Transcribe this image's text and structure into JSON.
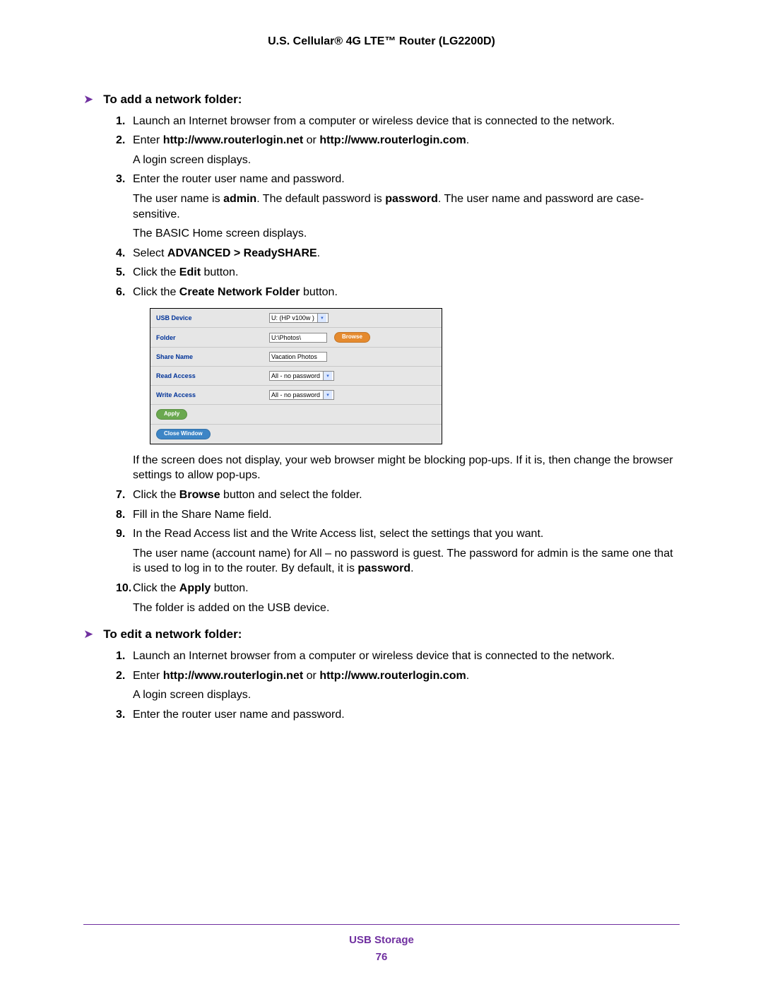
{
  "header": {
    "title": "U.S. Cellular® 4G LTE™ Router (LG2200D)"
  },
  "sections": {
    "add": {
      "heading": "To add a network folder:",
      "steps": {
        "1": {
          "num": "1.",
          "text": "Launch an Internet browser from a computer or wireless device that is connected to the network."
        },
        "2": {
          "num": "2.",
          "pre": "Enter ",
          "b1": "http://www.routerlogin.net",
          "mid": " or ",
          "b2": "http://www.routerlogin.com",
          "post": ".",
          "p1": "A login screen displays."
        },
        "3": {
          "num": "3.",
          "text": "Enter the router user name and password.",
          "p1a": "The user name is ",
          "p1b": "admin",
          "p1c": ". The default password is ",
          "p1d": "password",
          "p1e": ". The user name and password are case-sensitive.",
          "p2": "The BASIC Home screen displays."
        },
        "4": {
          "num": "4.",
          "pre": "Select ",
          "b1": "ADVANCED > ReadySHARE",
          "post": "."
        },
        "5": {
          "num": "5.",
          "pre": "Click the ",
          "b1": "Edit",
          "post": " button."
        },
        "6": {
          "num": "6.",
          "pre": "Click the ",
          "b1": "Create Network Folder",
          "post": " button.",
          "after": "If the screen does not display, your web browser might be blocking pop-ups. If it is, then change the browser settings to allow pop-ups."
        },
        "7": {
          "num": "7.",
          "pre": "Click the ",
          "b1": "Browse",
          "post": " button and select the folder."
        },
        "8": {
          "num": "8.",
          "text": "Fill in the Share Name field."
        },
        "9": {
          "num": "9.",
          "text": "In the Read Access list and the Write Access list, select the settings that you want.",
          "p1a": "The user name (account name) for All – no password is guest. The password for admin is the same one that is used to log in to the router. By default, it is ",
          "p1b": "password",
          "p1c": "."
        },
        "10": {
          "num": "10.",
          "pre": "Click the ",
          "b1": "Apply",
          "post": " button.",
          "p1": "The folder is added on the USB device."
        }
      }
    },
    "edit": {
      "heading": "To edit a network folder:",
      "steps": {
        "1": {
          "num": "1.",
          "text": "Launch an Internet browser from a computer or wireless device that is connected to the network."
        },
        "2": {
          "num": "2.",
          "pre": "Enter ",
          "b1": "http://www.routerlogin.net",
          "mid": " or ",
          "b2": "http://www.routerlogin.com",
          "post": ".",
          "p1": "A login screen displays."
        },
        "3": {
          "num": "3.",
          "text": "Enter the router user name and password."
        }
      }
    }
  },
  "shot": {
    "rows": {
      "usb_device": {
        "label": "USB Device",
        "value": "U: (HP v100w )"
      },
      "folder": {
        "label": "Folder",
        "value": "U:\\Photos\\",
        "browse": "Browse"
      },
      "share_name": {
        "label": "Share Name",
        "value": "Vacation Photos"
      },
      "read": {
        "label": "Read Access",
        "value": "All - no password"
      },
      "write": {
        "label": "Write Access",
        "value": "All - no password"
      }
    },
    "buttons": {
      "apply": "Apply",
      "close": "Close Window"
    }
  },
  "footer": {
    "section": "USB Storage",
    "page": "76"
  }
}
